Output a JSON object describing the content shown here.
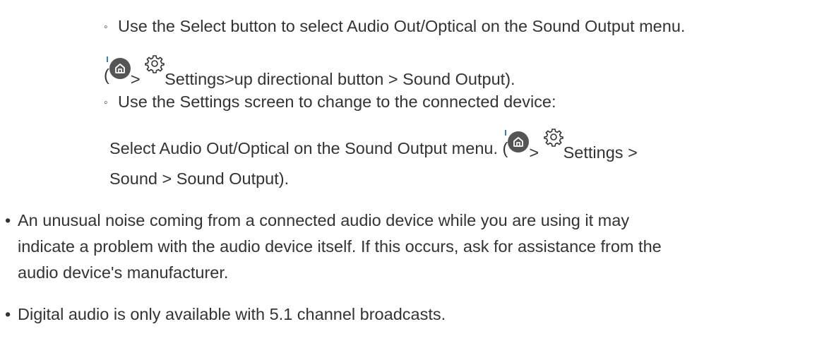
{
  "content": {
    "sub1_text": "Use the Select button to select Audio Out/Optical on the Sound Output menu.",
    "sub1_path_open": "(",
    "sub1_path_gt": ">",
    "sub1_path_rest": "Settings>up directional button > Sound Output).",
    "sub2_text": "Use the Settings screen to change to the connected device:",
    "sub2_line2_text": "Select Audio Out/Optical on the Sound Output menu. (",
    "sub2_line2_gt": ">",
    "sub2_line2_rest": "Settings >",
    "sub2_line3_text": "Sound > Sound Output).",
    "bullet1_line1": "An unusual noise coming from a connected audio device while you are using it may",
    "bullet1_line2": "indicate a problem with the audio device itself. If this occurs, ask for assistance from the",
    "bullet1_line3": "audio device's manufacturer.",
    "bullet2": "Digital audio is only available with 5.1 channel broadcasts.",
    "sub_bullet_glyph": "◦",
    "bullet_glyph": "•"
  },
  "icons": {
    "home": "home-icon",
    "settings": "gear-icon"
  },
  "colors": {
    "text": "#333333",
    "icon_fill": "#555555",
    "accent": "#2d7fd3"
  }
}
